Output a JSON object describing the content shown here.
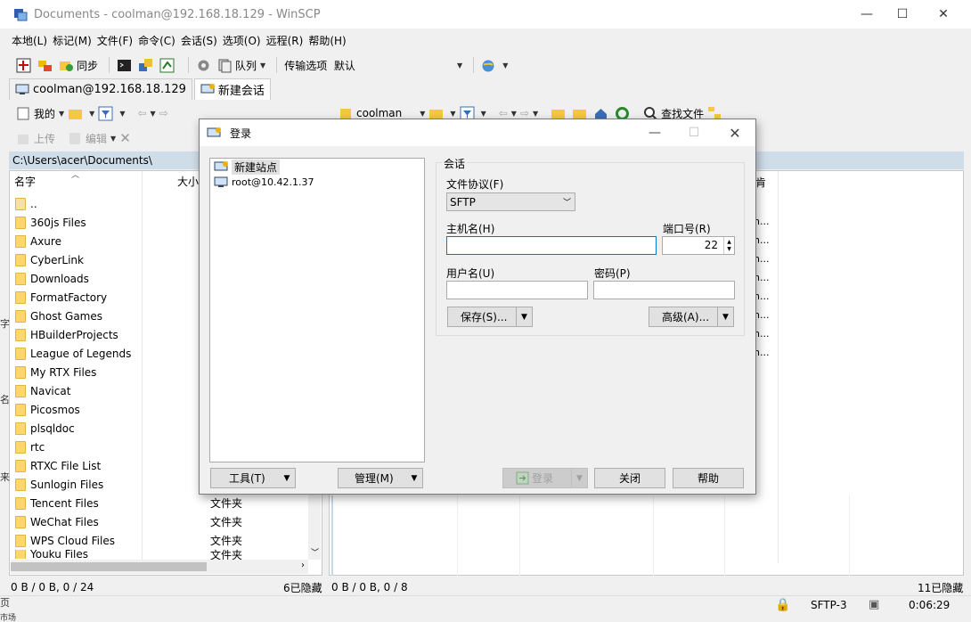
{
  "window": {
    "title": "Documents - coolman@192.168.18.129 - WinSCP",
    "minimize": "—",
    "maximize": "☐",
    "close": "✕"
  },
  "menu": [
    "本地(L)",
    "标记(M)",
    "文件(F)",
    "命令(C)",
    "会话(S)",
    "选项(O)",
    "远程(R)",
    "帮助(H)"
  ],
  "toolbar1": {
    "sync_label": "同步",
    "queue_label": "队列",
    "transfer_label": "传输选项",
    "transfer_value": "默认"
  },
  "session_tabs": [
    {
      "label": "coolman@192.168.18.129"
    },
    {
      "label": "新建会话"
    }
  ],
  "left_nav": {
    "location": "我的",
    "upload": "上传",
    "edit": "编辑"
  },
  "right_nav": {
    "location": "coolman",
    "find": "查找文件"
  },
  "left_path": "C:\\Users\\acer\\Documents\\",
  "left_columns": {
    "name": "名字",
    "size": "大小",
    "right_changed": "肯"
  },
  "files": [
    {
      "name": "..",
      "type": ""
    },
    {
      "name": "360js Files",
      "type": ""
    },
    {
      "name": "Axure",
      "type": ""
    },
    {
      "name": "CyberLink",
      "type": ""
    },
    {
      "name": "Downloads",
      "type": ""
    },
    {
      "name": "FormatFactory",
      "type": ""
    },
    {
      "name": "Ghost Games",
      "type": ""
    },
    {
      "name": "HBuilderProjects",
      "type": ""
    },
    {
      "name": "League of Legends",
      "type": ""
    },
    {
      "name": "My RTX Files",
      "type": ""
    },
    {
      "name": "Navicat",
      "type": ""
    },
    {
      "name": "Picosmos",
      "type": ""
    },
    {
      "name": "plsqldoc",
      "type": ""
    },
    {
      "name": "rtc",
      "type": ""
    },
    {
      "name": "RTXC File List",
      "type": ""
    },
    {
      "name": "Sunlogin Files",
      "type": ""
    },
    {
      "name": "Tencent Files",
      "type": "文件夹"
    },
    {
      "name": "WeChat Files",
      "type": "文件夹"
    },
    {
      "name": "WPS Cloud Files",
      "type": "文件夹"
    },
    {
      "name": "Youku Files",
      "type": "文件夹"
    }
  ],
  "right_truncated": [
    "n...",
    "n...",
    "n...",
    "n...",
    "n...",
    "n...",
    "n...",
    "n..."
  ],
  "status": {
    "left_sel": "0 B / 0 B,  0 / 24",
    "left_hidden": "6已隐藏",
    "right_sel": "0 B / 0 B,  0 / 8",
    "right_hidden": "11已隐藏",
    "protocol": "SFTP-3",
    "time": "0:06:29"
  },
  "left_edge": [
    "字",
    "名",
    "来",
    "页",
    "市场"
  ],
  "dialog": {
    "title": "登录",
    "sites": [
      {
        "label": "新建站点"
      },
      {
        "label": "root@10.42.1.37"
      }
    ],
    "group_label": "会话",
    "protocol_label": "文件协议(F)",
    "protocol_value": "SFTP",
    "host_label": "主机名(H)",
    "host_value": "",
    "port_label": "端口号(R)",
    "port_value": "22",
    "user_label": "用户名(U)",
    "user_value": "",
    "pass_label": "密码(P)",
    "pass_value": "",
    "save_label": "保存(S)...",
    "advanced_label": "高级(A)...",
    "tools_label": "工具(T)",
    "manage_label": "管理(M)",
    "login_label": "登录",
    "close_label": "关闭",
    "help_label": "帮助"
  }
}
